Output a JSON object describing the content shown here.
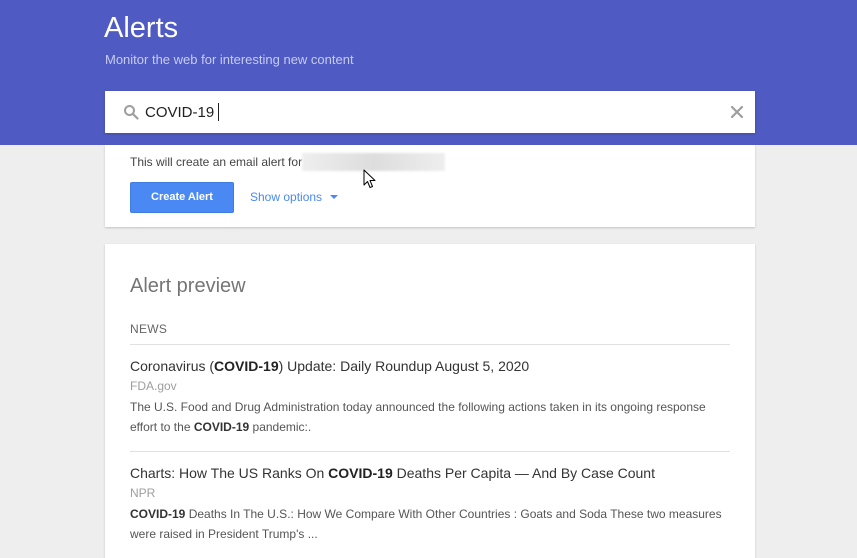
{
  "header": {
    "title": "Alerts",
    "subtitle": "Monitor the web for interesting new content",
    "background_color": "#4f5bc2"
  },
  "search": {
    "value": "COVID-19",
    "icon": "search-icon",
    "clear_icon": "close-icon"
  },
  "options": {
    "email_prefix": "This will create an email alert for",
    "create_label": "Create Alert",
    "show_options_label": "Show options",
    "accent_color": "#4a89f3"
  },
  "preview": {
    "title": "Alert preview",
    "section": "NEWS",
    "articles": [
      {
        "title_pre": "Coronavirus (",
        "title_bold": "COVID-19",
        "title_post": ") Update: Daily Roundup August 5, 2020",
        "source": "FDA.gov",
        "snippet_pre": "The U.S. Food and Drug Administration today announced the following actions taken in its ongoing response effort to the ",
        "snippet_bold": "COVID-19",
        "snippet_post": " pandemic:."
      },
      {
        "title_pre": "Charts: How The US Ranks On ",
        "title_bold": "COVID-19",
        "title_post": " Deaths Per Capita — And By Case Count",
        "source": "NPR",
        "snippet_pre": "",
        "snippet_bold": "COVID-19",
        "snippet_post": " Deaths In The U.S.: How We Compare With Other Countries : Goats and Soda These two measures were raised in President Trump's ..."
      }
    ]
  }
}
